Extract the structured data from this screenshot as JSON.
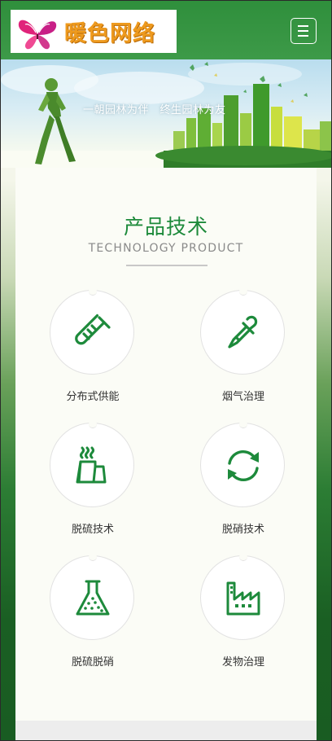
{
  "header": {
    "logo_text": "暖色网络",
    "logo_icon": "butterfly-icon",
    "menu_icon": "hamburger-menu-icon"
  },
  "banner": {
    "slogan": "一朝园林为伴　终生园林为友"
  },
  "section": {
    "title": "产品技术",
    "subtitle": "TECHNOLOGY PRODUCT"
  },
  "products": [
    {
      "label": "分布式供能",
      "icon": "test-tube-icon"
    },
    {
      "label": "烟气治理",
      "icon": "dropper-icon"
    },
    {
      "label": "脱硫技术",
      "icon": "factory-chimney-icon"
    },
    {
      "label": "脱硝技术",
      "icon": "recycle-arrows-icon"
    },
    {
      "label": "脱硫脱硝",
      "icon": "flask-icon"
    },
    {
      "label": "发物治理",
      "icon": "factory-icon"
    }
  ],
  "colors": {
    "brand_green": "#1d8a3b",
    "header_green": "#3a9a46",
    "logo_orange": "#ee9a1e",
    "logo_magenta": "#d6266e"
  }
}
